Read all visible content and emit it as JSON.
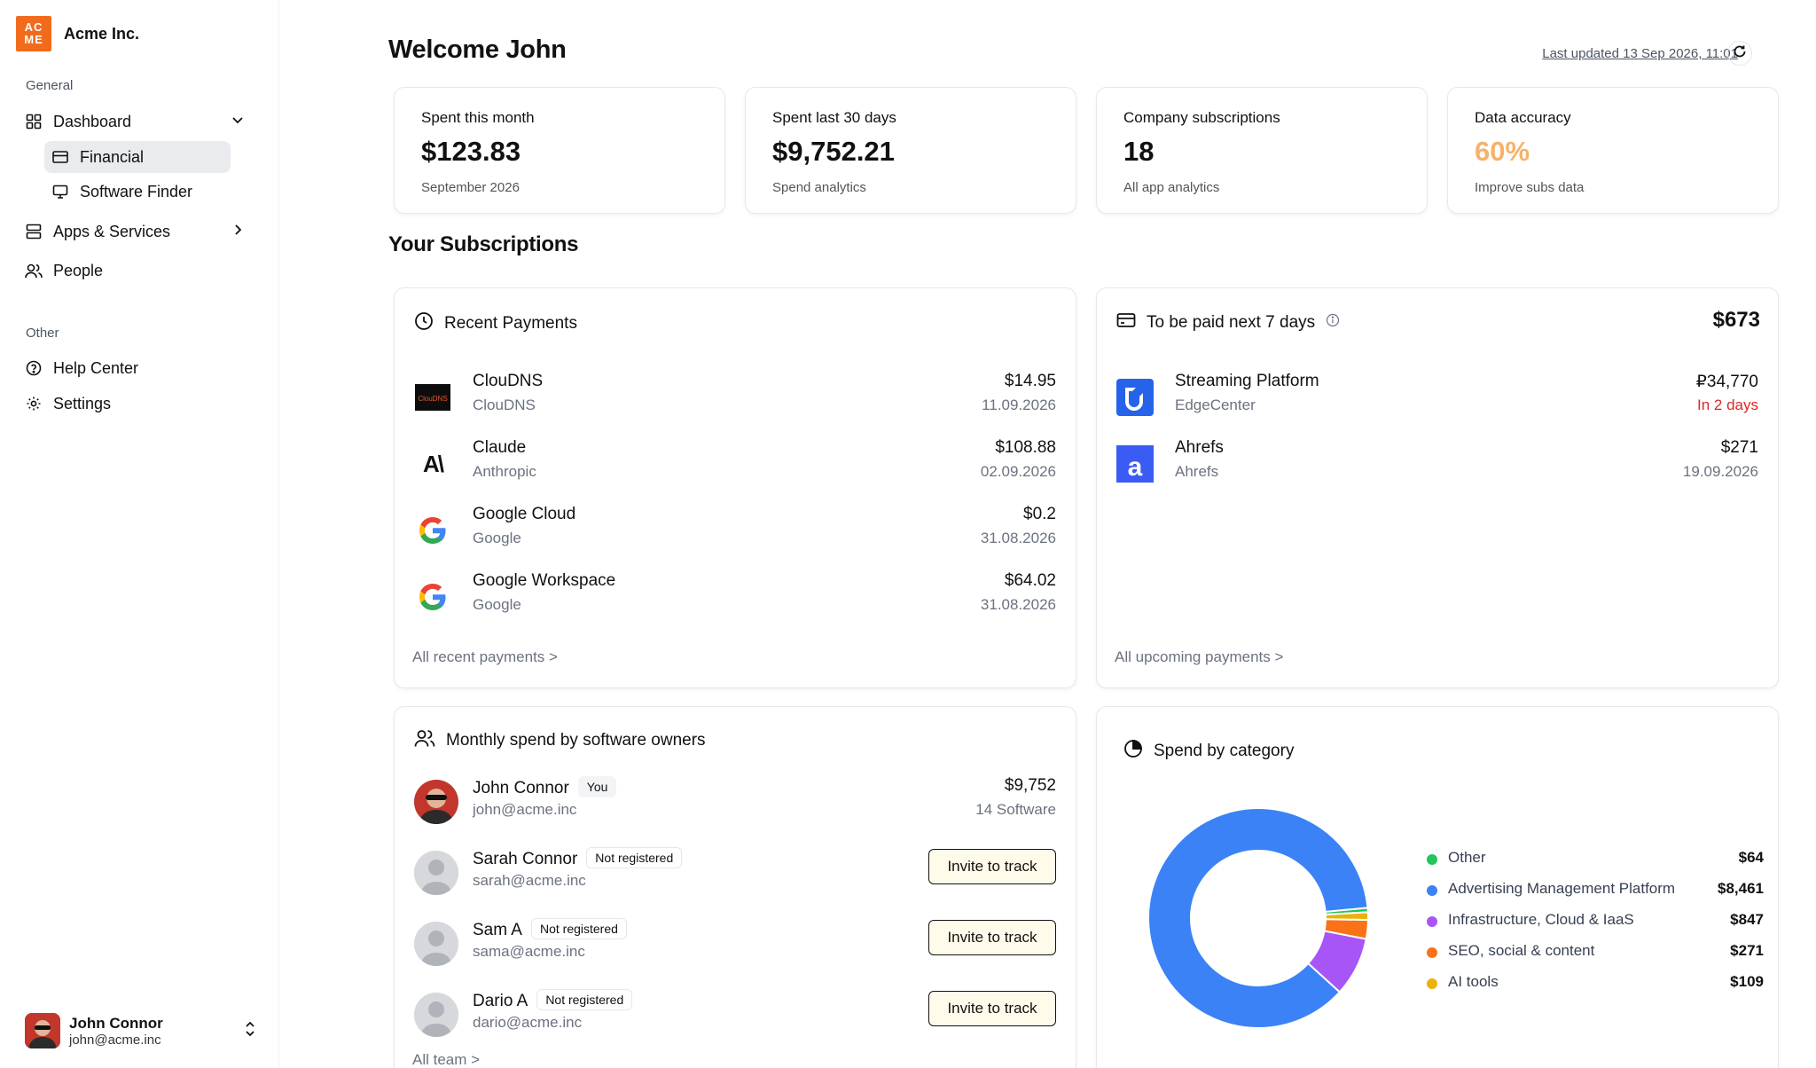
{
  "sidebar": {
    "brand_logo_text": [
      "AC",
      "ME"
    ],
    "brand_name": "Acme Inc.",
    "section_general": "General",
    "dashboard": "Dashboard",
    "financial": "Financial",
    "software_finder": "Software Finder",
    "apps_services": "Apps & Services",
    "people": "People",
    "section_other": "Other",
    "help_center": "Help Center",
    "settings": "Settings",
    "user_name": "John Connor",
    "user_email": "john@acme.inc"
  },
  "header": {
    "title": "Welcome John",
    "last_updated": "Last updated 13 Sep 2026, 11:01"
  },
  "stats": [
    {
      "label": "Spent this month",
      "value": "$123.83",
      "sub": "September 2026",
      "color": "#111111"
    },
    {
      "label": "Spent last 30 days",
      "value": "$9,752.21",
      "sub": "Spend analytics",
      "color": "#111111"
    },
    {
      "label": "Company subscriptions",
      "value": "18",
      "sub": "All app analytics",
      "color": "#111111"
    },
    {
      "label": "Data accuracy",
      "value": "60%",
      "sub": "Improve subs data",
      "color": "#f5b26b"
    }
  ],
  "subscriptions_heading": "Your Subscriptions",
  "recent_payments": {
    "title": "Recent Payments",
    "items": [
      {
        "name": "ClouDNS",
        "vendor": "ClouDNS",
        "amount": "$14.95",
        "date": "11.09.2026",
        "logo_text": "ClouDNS"
      },
      {
        "name": "Claude",
        "vendor": "Anthropic",
        "amount": "$108.88",
        "date": "02.09.2026",
        "logo_text": "A\\"
      },
      {
        "name": "Google Cloud",
        "vendor": "Google",
        "amount": "$0.2",
        "date": "31.08.2026"
      },
      {
        "name": "Google Workspace",
        "vendor": "Google",
        "amount": "$64.02",
        "date": "31.08.2026"
      }
    ],
    "link": "All recent payments >"
  },
  "upcoming": {
    "title": "To be paid next 7 days",
    "total": "$673",
    "items": [
      {
        "name": "Streaming Platform",
        "vendor": "EdgeCenter",
        "amount": "₽34,770",
        "date": "In 2 days"
      },
      {
        "name": "Ahrefs",
        "vendor": "Ahrefs",
        "amount": "$271",
        "date": "19.09.2026",
        "logo_text": "a"
      }
    ],
    "link": "All upcoming payments >"
  },
  "owners": {
    "title": "Monthly spend by software owners",
    "you_badge": "You",
    "not_registered": "Not registered",
    "invite_label": "Invite to track",
    "me": {
      "name": "John Connor",
      "email": "john@acme.inc",
      "amount": "$9,752",
      "count": "14 Software"
    },
    "others": [
      {
        "name": "Sarah Connor",
        "email": "sarah@acme.inc"
      },
      {
        "name": "Sam A",
        "email": "sama@acme.inc"
      },
      {
        "name": "Dario A",
        "email": "dario@acme.inc"
      }
    ],
    "link": "All team >"
  },
  "category": {
    "title": "Spend by category"
  },
  "chart_data": {
    "type": "pie",
    "title": "Spend by category",
    "categories": [
      "Other",
      "Advertising Management Platform",
      "Infrastructure, Cloud & IaaS",
      "SEO, social & content",
      "AI tools"
    ],
    "values": [
      64,
      8461,
      847,
      271,
      109
    ],
    "labels": [
      "$64",
      "$8,461",
      "$847",
      "$271",
      "$109"
    ],
    "colors": [
      "#22c55e",
      "#3b82f6",
      "#a855f7",
      "#f97316",
      "#eab308"
    ],
    "donut": true,
    "legend": "right"
  }
}
